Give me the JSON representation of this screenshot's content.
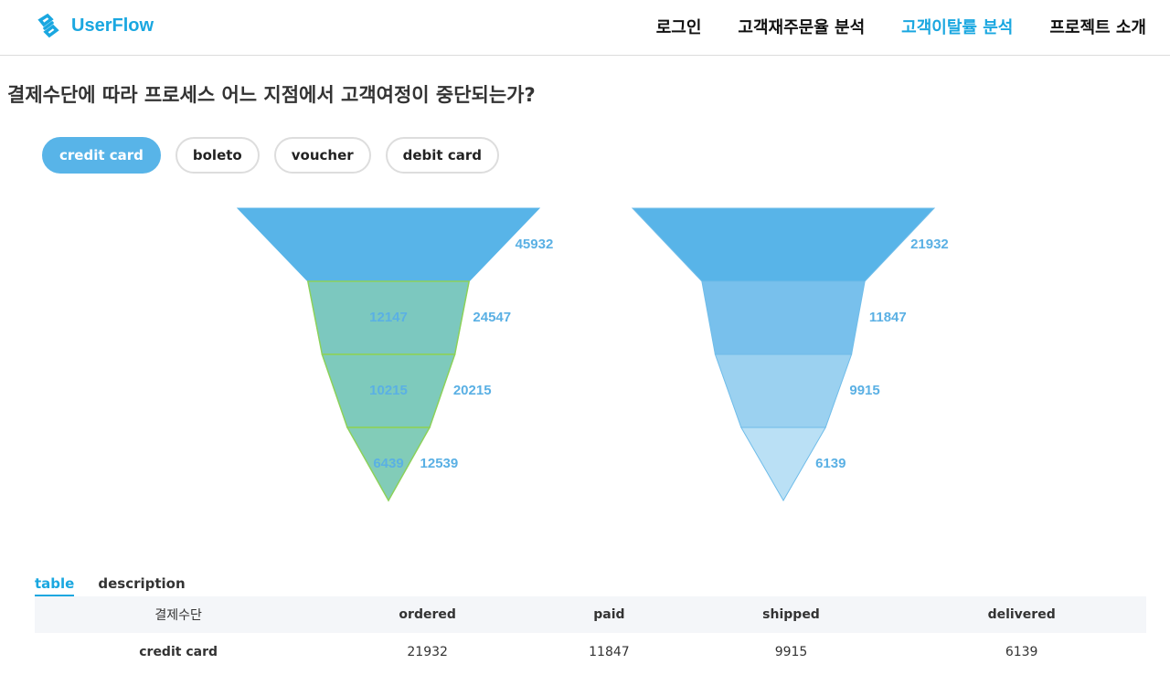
{
  "brand": {
    "name": "UserFlow",
    "logo_icon": "link-icon",
    "color": "#1aa7e0"
  },
  "nav": [
    {
      "label": "로그인",
      "active": false
    },
    {
      "label": "고객재주문율 분석",
      "active": false
    },
    {
      "label": "고객이탈률 분석",
      "active": true
    },
    {
      "label": "프로젝트 소개",
      "active": false
    }
  ],
  "question": "결제수단에 따라 프로세스 어느 지점에서 고객여정이 중단되는가?",
  "payment_filters": [
    {
      "label": "credit card",
      "active": true
    },
    {
      "label": "boleto",
      "active": false
    },
    {
      "label": "voucher",
      "active": false
    },
    {
      "label": "debit card",
      "active": false
    }
  ],
  "chart_data": [
    {
      "type": "funnel",
      "stages": [
        "ordered",
        "paid",
        "shipped",
        "delivered"
      ],
      "series": [
        {
          "values": [
            45932,
            24547,
            20215,
            12539
          ],
          "color": "#58b4e8"
        },
        {
          "values": [
            45932,
            12147,
            10215,
            6439
          ],
          "color": "#94d6a4"
        }
      ],
      "labels": [
        "45932",
        "24547",
        "20215",
        "12539"
      ],
      "inner_labels": [
        "12147",
        "10215",
        "6439"
      ]
    },
    {
      "type": "funnel",
      "stages": [
        "ordered",
        "paid",
        "shipped",
        "delivered"
      ],
      "values": [
        21932,
        11847,
        9915,
        6139
      ],
      "colors": [
        "#58b4e8",
        "#78c0ec",
        "#9bd1f0",
        "#bae0f5"
      ],
      "labels": [
        "21932",
        "11847",
        "9915",
        "6139"
      ]
    }
  ],
  "tabs": [
    {
      "label": "table",
      "active": true
    },
    {
      "label": "description",
      "active": false
    }
  ],
  "table": {
    "headers": [
      "결제수단",
      "ordered",
      "paid",
      "shipped",
      "delivered"
    ],
    "rows": [
      [
        "credit card",
        "21932",
        "11847",
        "9915",
        "6139"
      ]
    ]
  }
}
